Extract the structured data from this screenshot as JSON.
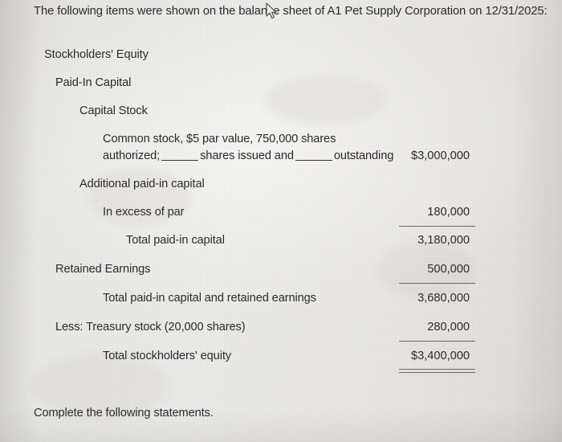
{
  "document": {
    "intro": "The following items were shown on the balance sheet of A1 Pet Supply Corporation on 12/31/2025:",
    "footer": "Complete the following statements.",
    "heading": "Stockholders' Equity",
    "subheading": "Paid-In Capital",
    "section": "Capital Stock",
    "common_stock_line1": "Common stock, $5 par value, 750,000 shares",
    "common_stock_line2_pre": "authorized;",
    "common_stock_line2_mid": "shares issued and",
    "common_stock_line2_post": "outstanding",
    "rows": [
      {
        "label": "Additional paid-in capital",
        "amount": ""
      },
      {
        "label": "In excess of par",
        "amount": "180,000"
      },
      {
        "label": "Total paid-in capital",
        "amount": "3,180,000"
      },
      {
        "label": "Retained Earnings",
        "amount": "500,000"
      },
      {
        "label": "Total paid-in capital and retained earnings",
        "amount": "3,680,000"
      },
      {
        "label": "Less: Treasury stock (20,000 shares)",
        "amount": "280,000"
      },
      {
        "label": "Total stockholders' equity",
        "amount": "$3,400,000"
      }
    ],
    "common_stock_amount": "$3,000,000"
  },
  "colors": {
    "paper": "#e8e6e2",
    "ink": "#2e2c2c",
    "rule": "#57534f"
  },
  "cursor": {
    "icon": "mouse-pointer-icon"
  }
}
